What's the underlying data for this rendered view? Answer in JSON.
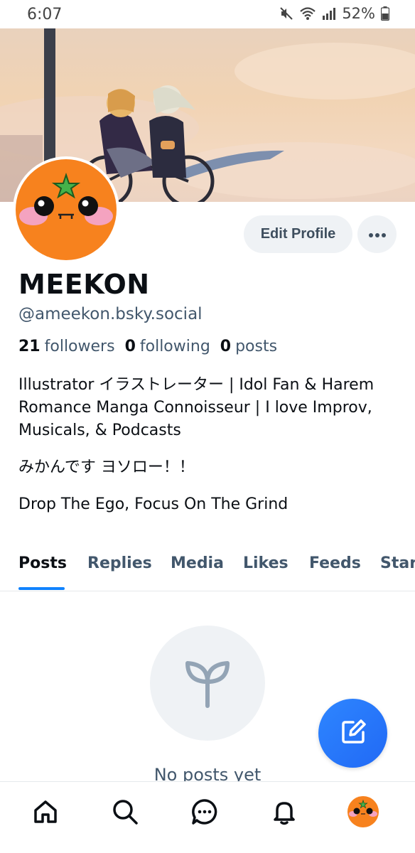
{
  "status_bar": {
    "time": "6:07",
    "battery": "52%",
    "icons": [
      "mute-icon",
      "wifi-icon",
      "signal-icon",
      "battery-icon"
    ]
  },
  "profile": {
    "display_name": "MEEKON",
    "handle": "@ameekon.bsky.social",
    "followers_count": "21",
    "followers_label": "followers",
    "following_count": "0",
    "following_label": "following",
    "posts_count": "0",
    "posts_label": "posts",
    "bio": [
      "Illustrator イラストレーター | Idol Fan & Harem Romance Manga Connoisseur | I love Improv, Musicals, & Podcasts",
      "みかんです ヨソロー！！",
      "Drop The Ego, Focus On The Grind"
    ]
  },
  "actions": {
    "edit_profile_label": "Edit Profile",
    "more_icon": "ellipsis-icon"
  },
  "tabs": [
    {
      "label": "Posts",
      "active": true
    },
    {
      "label": "Replies",
      "active": false
    },
    {
      "label": "Media",
      "active": false
    },
    {
      "label": "Likes",
      "active": false
    },
    {
      "label": "Feeds",
      "active": false
    },
    {
      "label": "Starter Packs",
      "active": false
    }
  ],
  "empty_state": {
    "icon": "sprout-icon",
    "text": "No posts yet"
  },
  "fab": {
    "icon": "compose-icon"
  },
  "bottom_nav": [
    {
      "icon": "home-icon"
    },
    {
      "icon": "search-icon"
    },
    {
      "icon": "chat-icon"
    },
    {
      "icon": "bell-icon"
    },
    {
      "icon": "profile-avatar"
    }
  ],
  "colors": {
    "accent": "#1083fe",
    "fab": "#2169f5",
    "muted_text": "#42576c",
    "button_bg": "#eff2f5",
    "avatar_orange": "#f7821e"
  }
}
